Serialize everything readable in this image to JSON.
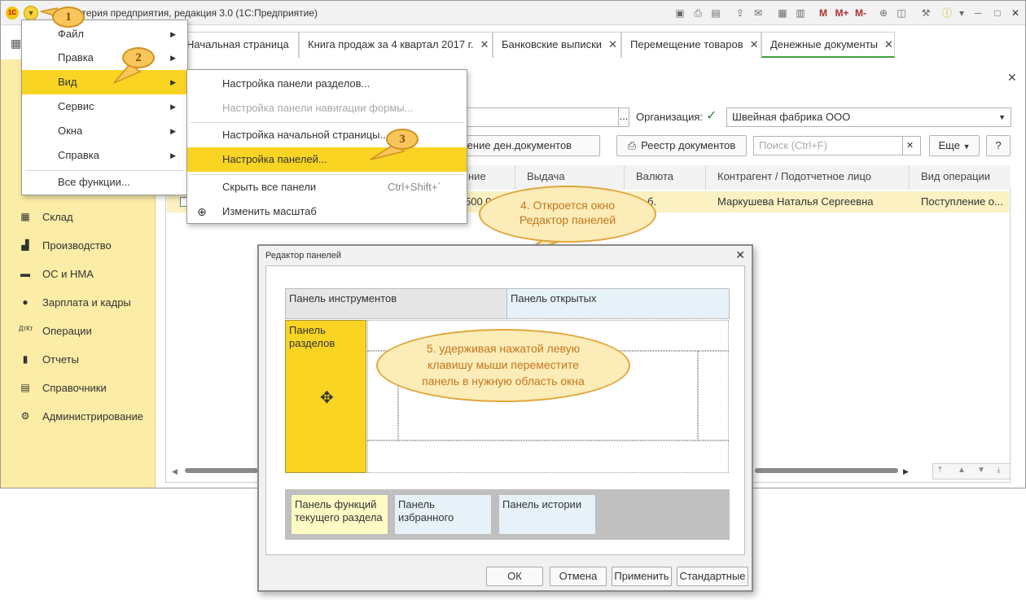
{
  "window": {
    "title": "Бухгалтерия предприятия, редакция 3.0  (1С:Предприятие)",
    "title_hidden_prefix": "Бу",
    "toolbar_m": [
      "M",
      "M+",
      "M-"
    ]
  },
  "tabs": [
    {
      "label": "Начальная страница"
    },
    {
      "label": "Книга продаж за 4 квартал 2017 г."
    },
    {
      "label": "Банковские выписки"
    },
    {
      "label": "Перемещение товаров"
    },
    {
      "label": "Денежные документы"
    }
  ],
  "sidebar": {
    "items": [
      {
        "label": "Склад",
        "icon": "warehouse-icon"
      },
      {
        "label": "Производство",
        "icon": "factory-icon"
      },
      {
        "label": "ОС и НМА",
        "icon": "truck-icon"
      },
      {
        "label": "Зарплата и кадры",
        "icon": "person-icon"
      },
      {
        "label": "Операции",
        "icon": "dt-kt-icon"
      },
      {
        "label": "Отчеты",
        "icon": "chart-icon"
      },
      {
        "label": "Справочники",
        "icon": "books-icon"
      },
      {
        "label": "Администрирование",
        "icon": "gear-icon"
      }
    ]
  },
  "main": {
    "org_label": "Организация:",
    "org_value": "Швейная фабрика ООО",
    "btn_movement": "Движение ден.документов",
    "btn_registry": "Реестр документов",
    "search_placeholder": "Поиск (Ctrl+F)",
    "btn_more": "Еще",
    "btn_help": "?",
    "columns": [
      "ние",
      "Выдача",
      "Валюта",
      "Контрагент / Подотчетное лицо",
      "Вид операции"
    ],
    "row": {
      "amount": "500 0",
      "currency": "б.",
      "counterparty": "Маркушева Наталья Сергеевна",
      "operation": "Поступление о..."
    }
  },
  "main_menu": {
    "items": [
      {
        "label": "Файл"
      },
      {
        "label": "Правка"
      },
      {
        "label": "Вид"
      },
      {
        "label": "Сервис"
      },
      {
        "label": "Окна"
      },
      {
        "label": "Справка"
      },
      {
        "label": "Все функции..."
      }
    ]
  },
  "view_menu": {
    "items": [
      {
        "label": "Настройка панели разделов..."
      },
      {
        "label": "Настройка панели навигации формы..."
      },
      {
        "label": "Настройка начальной страницы..."
      },
      {
        "label": "Настройка панелей..."
      },
      {
        "label": "Скрыть все панели",
        "shortcut": "Ctrl+Shift+`"
      },
      {
        "label": "Изменить масштаб"
      }
    ]
  },
  "callouts": {
    "n1": "1",
    "n2": "2",
    "n3": "3",
    "c4_line1": "4. Откроется окно",
    "c4_line2": "Редактор панелей",
    "c5_line1": "5. удерживая нажатой левую",
    "c5_line2": "клавишу мыши переместите",
    "c5_line3": "панель в нужную область окна"
  },
  "dialog": {
    "title": "Редактор панелей",
    "panel_tools": "Панель инструментов",
    "panel_open": "Панель открытых",
    "panel_sections_1": "Панель",
    "panel_sections_2": "разделов",
    "panel_functions_1": "Панель функций",
    "panel_functions_2": "текущего раздела",
    "panel_favorites_1": "Панель",
    "panel_favorites_2": "избранного",
    "panel_history": "Панель истории",
    "ok": "ОК",
    "cancel": "Отмена",
    "apply": "Применить",
    "standard": "Стандартные"
  },
  "colors": {
    "accent_yellow": "#f9d423",
    "sidebar_bg": "#fbeca6",
    "callout_border": "#e0a63c",
    "callout_text": "#c3781e",
    "active_tab_underline": "#3fa23f",
    "light_blue_panel": "#e6f2f8",
    "light_yellow_panel": "#fffbc4"
  }
}
